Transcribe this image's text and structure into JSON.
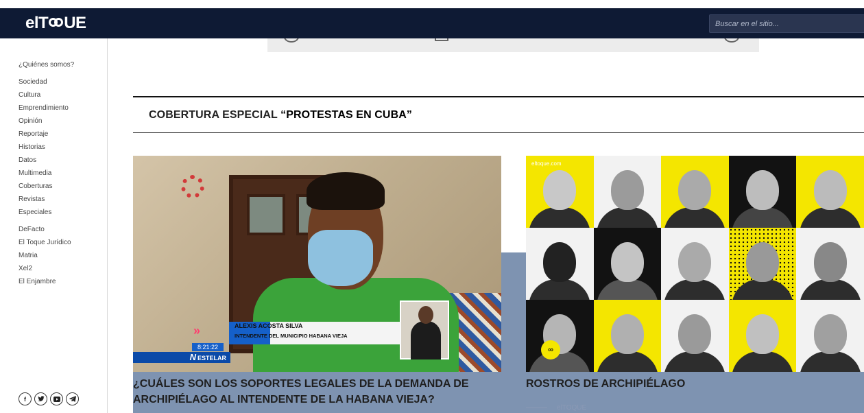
{
  "header": {
    "logo": "elTOQUE",
    "logo_left": "elT",
    "logo_right": "UE",
    "search_placeholder": "Buscar en el sitio..."
  },
  "sidebar": {
    "about": "¿Quiénes somos?",
    "sections": [
      "Sociedad",
      "Cultura",
      "Emprendimiento",
      "Opinión",
      "Reportaje",
      "Historias",
      "Datos",
      "Multimedia",
      "Coberturas",
      "Revistas",
      "Especiales"
    ],
    "projects": [
      "DeFacto",
      "El Toque Jurídico",
      "Matria",
      "Xel2",
      "El Enjambre"
    ],
    "social_icons": [
      "facebook-icon",
      "twitter-icon",
      "youtube-icon",
      "telegram-icon"
    ]
  },
  "section": {
    "prefix": "COBERTURA ESPECIAL ",
    "highlight": "“PROTESTAS EN CUBA”"
  },
  "cards": [
    {
      "title": "¿Cuáles son los soportes legales de la demanda de Archipiélago al intendente de La Habana Vieja?",
      "image": {
        "lower_third_name": "ALEXIS ACOSTA SILVA",
        "lower_third_role": "INTENDENTE DEL MUNICIPIO HABANA VIEJA",
        "time": "8:21:22",
        "program": "ESTELAR",
        "program_letter": "N"
      }
    },
    {
      "title": "Rostros de Archipiélago",
      "byline": "elTOQUE",
      "image": {
        "watermark": "eltoque.com"
      }
    }
  ],
  "colors": {
    "header_bg": "#0e1a34",
    "blue_band": "#7e93b1",
    "accent_yellow": "#f4e600"
  }
}
